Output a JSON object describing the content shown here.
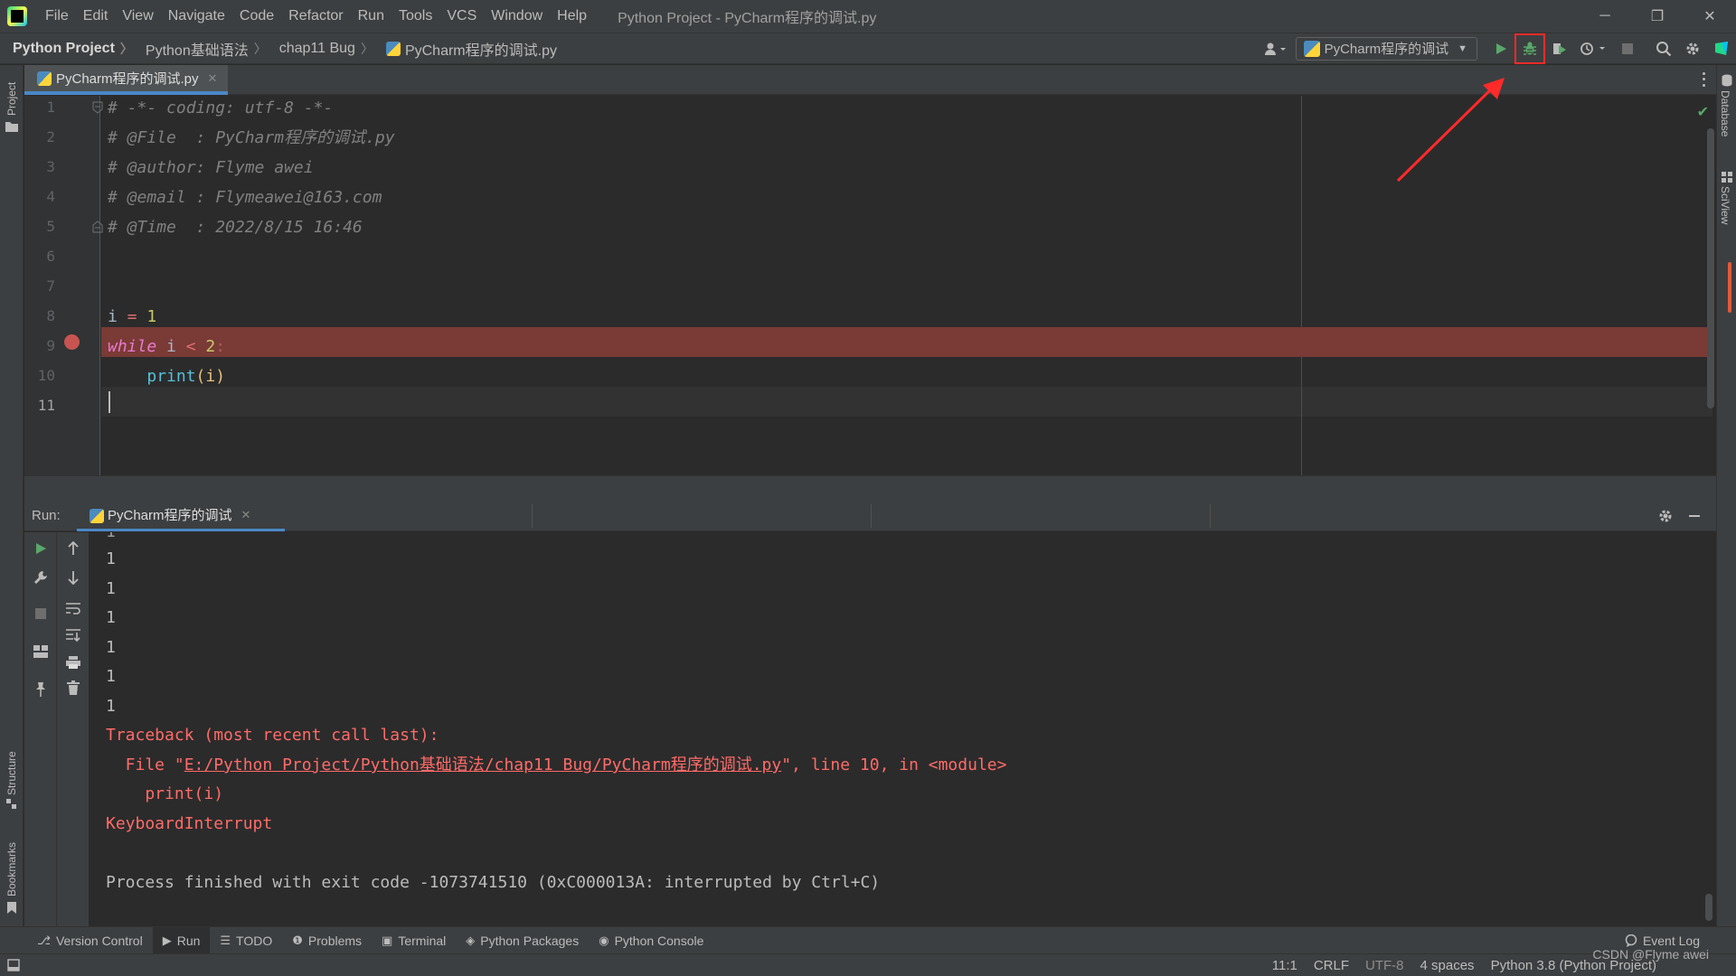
{
  "menubar": {
    "items": [
      "File",
      "Edit",
      "View",
      "Navigate",
      "Code",
      "Refactor",
      "Run",
      "Tools",
      "VCS",
      "Window",
      "Help"
    ],
    "title": "Python Project - PyCharm程序的调试.py"
  },
  "window_controls": {
    "minimize": "─",
    "restore": "❐",
    "close": "✕"
  },
  "breadcrumb": [
    "Python Project",
    "Python基础语法",
    "chap11 Bug",
    "PyCharm程序的调试.py"
  ],
  "toolbar": {
    "run_config": "PyCharm程序的调试"
  },
  "left_strip": {
    "project": "Project",
    "structure": "Structure",
    "bookmarks": "Bookmarks"
  },
  "right_strip": {
    "database": "Database",
    "sciview": "SciView"
  },
  "editor": {
    "tab_label": "PyCharm程序的调试.py",
    "line_numbers": [
      "1",
      "2",
      "3",
      "4",
      "5",
      "6",
      "7",
      "8",
      "9",
      "10",
      "11"
    ],
    "comments": [
      "# -*- coding: utf-8 -*-",
      "# @File  : PyCharm程序的调试.py",
      "# @author: Flyme awei",
      "# @email : Flymeawei@163.com",
      "# @Time  : 2022/8/15 16:46"
    ],
    "line8": {
      "var": "i",
      "op": " = ",
      "val": "1"
    },
    "line9": {
      "kw": "while",
      "rest": " i ",
      "op": "<",
      "val": " 2",
      "colon": ":"
    },
    "line10": {
      "indent": "    ",
      "fn": "print",
      "args": "(i)"
    }
  },
  "run_panel": {
    "label": "Run:",
    "tab_label": "PyCharm程序的调试",
    "output_numbers": [
      "1",
      "1",
      "1",
      "1",
      "1",
      "1",
      "1"
    ],
    "traceback_header": "Traceback (most recent call last):",
    "file_prefix": "  File \"",
    "file_link": "E:/Python Project/Python基础语法/chap11 Bug/PyCharm程序的调试.py",
    "file_suffix": "\", line 10, in <module>",
    "code_line": "    print(i)",
    "exception": "KeyboardInterrupt",
    "exit_message": "Process finished with exit code -1073741510 (0xC000013A: interrupted by Ctrl+C)"
  },
  "bottom_tools": [
    {
      "icon": "⎇",
      "label": "Version Control"
    },
    {
      "icon": "▶",
      "label": "Run"
    },
    {
      "icon": "☰",
      "label": "TODO"
    },
    {
      "icon": "❶",
      "label": "Problems"
    },
    {
      "icon": "▣",
      "label": "Terminal"
    },
    {
      "icon": "◈",
      "label": "Python Packages"
    },
    {
      "icon": "◉",
      "label": "Python Console"
    }
  ],
  "event_log": "Event Log",
  "statusbar": {
    "position": "11:1",
    "line_sep": "CRLF",
    "encoding": "UTF-8",
    "indent": "4 spaces",
    "interpreter": "Python 3.8 (Python Project)"
  },
  "watermark": "CSDN @Flyme awei",
  "colors": {
    "breakpoint_line": "#7a3a36",
    "breakpoint_dot": "#c75450",
    "error_text": "#ff6b68",
    "accent_tab": "#4a88c7",
    "annotation": "#ff2a2a"
  }
}
